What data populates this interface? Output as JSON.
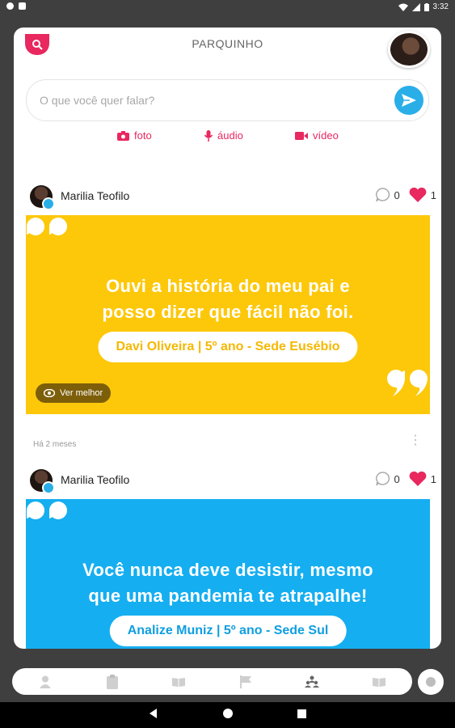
{
  "statusbar": {
    "time": "3:32"
  },
  "header": {
    "title": "PARQUINHO"
  },
  "compose": {
    "placeholder": "O que você quer falar?"
  },
  "media": {
    "photo": "foto",
    "audio": "áudio",
    "video": "vídeo"
  },
  "posts": [
    {
      "author": "Marilia Teofilo",
      "comments": "0",
      "likes": "1",
      "quote": "Ouvi a história do meu pai e posso dizer que fácil não foi.",
      "quote_line1": "Ouvi a história do meu pai e",
      "quote_line2": "posso dizer que fácil não foi.",
      "student": "Davi Oliveira | 5º ano - Sede Eusébio",
      "view_more": "Ver melhor",
      "time_ago": "Há 2 meses",
      "bg_color": "#fdc80a",
      "accent_color": "#f5b800"
    },
    {
      "author": "Marilia Teofilo",
      "comments": "0",
      "likes": "1",
      "quote_line1": "Você nunca deve desistir, mesmo",
      "quote_line2": "que uma pandemia te atrapalhe!",
      "student": "Analize Muniz | 5º ano - Sede Sul",
      "bg_color": "#15aef0",
      "accent_color": "#0f9ee0"
    }
  ],
  "colors": {
    "brand_pink": "#e8285f",
    "send_blue": "#29aee8",
    "heart_red": "#e8285f"
  },
  "icons": [
    "search-icon",
    "send-icon",
    "camera-icon",
    "microphone-icon",
    "video-icon",
    "comment-icon",
    "heart-icon",
    "eye-icon",
    "quote-icon",
    "user-icon",
    "clipboard-icon",
    "book-icon",
    "flag-icon",
    "group-icon"
  ]
}
